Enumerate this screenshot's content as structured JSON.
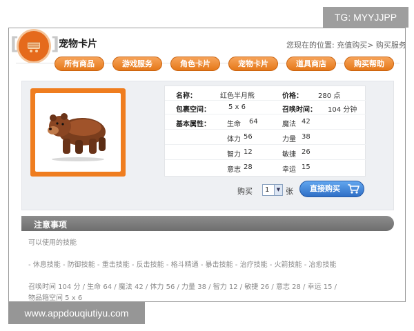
{
  "watermarks": {
    "top": "TG: MYYJJPP",
    "bottom": "www.appdouqiutiyu.com"
  },
  "header": {
    "title": "宠物卡片",
    "breadcrumb": "您现在的位置: 充值购买> 购买服务"
  },
  "nav": {
    "items": [
      "所有商品",
      "游戏服务",
      "角色卡片",
      "宠物卡片",
      "道具商店",
      "购买帮助"
    ]
  },
  "pet": {
    "image_icon": "bear-icon",
    "name_label": "名称：",
    "name_value": "红色半月熊",
    "price_label": "价格：",
    "price_value": "280 点",
    "bag_label": "包裹空间：",
    "bag_value": "5 x 6",
    "summon_label": "召唤时间：",
    "summon_value": "104 分钟",
    "base_label": "基本属性：",
    "stats": [
      {
        "name": "生命",
        "value": "64"
      },
      {
        "name": "魔法",
        "value": "42"
      },
      {
        "name": "体力",
        "value": "56"
      },
      {
        "name": "力量",
        "value": "38"
      },
      {
        "name": "智力",
        "value": "12"
      },
      {
        "name": "敏捷",
        "value": "26"
      },
      {
        "name": "意志",
        "value": "28"
      },
      {
        "name": "幸运",
        "value": "15"
      }
    ]
  },
  "buy": {
    "label": "购买",
    "quantity": "1",
    "unit": "张",
    "button": "直接购买"
  },
  "notes": {
    "title": "注意事项",
    "line1": "可以使用的技能",
    "line2": "- 休息技能 - 防御技能 - 重击技能 - 反击技能 - 格斗精通 - 暴击技能 - 治疗技能 - 火箭技能 - 冶愈技能",
    "line3": "召唤时间 104 分 / 生命 64 / 魔法 42 / 体力 56 / 力量 38 / 智力 12 / 敏捷 26 / 意志 28 / 幸运 15 /",
    "line4": "物品箱空间 5 x 6"
  },
  "colors": {
    "accent_orange": "#e57819",
    "buy_blue": "#2f6fc6",
    "notes_gray": "#7a7a7a"
  }
}
